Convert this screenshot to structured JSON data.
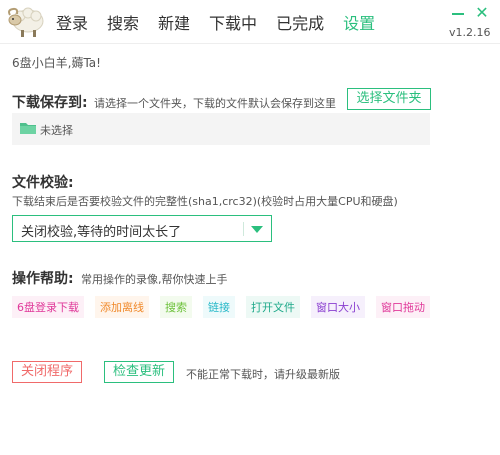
{
  "nav": {
    "items": [
      "登录",
      "搜索",
      "新建",
      "下载中",
      "已完成",
      "设置"
    ],
    "active": 5
  },
  "version": "v1.2.16",
  "greeting": "6盘小白羊,薅Ta!",
  "download": {
    "title": "下载保存到:",
    "desc": "请选择一个文件夹，下载的文件默认会保存到这里",
    "choose_button": "选择文件夹",
    "current_path": "未选择"
  },
  "verify": {
    "title": "文件校验:",
    "desc": "下载结束后是否要校验文件的完整性(sha1,crc32)(校验时占用大量CPU和硬盘)",
    "selected": "关闭校验,等待的时间太长了"
  },
  "help": {
    "title": "操作帮助:",
    "desc": "常用操作的录像,帮你快速上手",
    "links": [
      {
        "label": "6盘登录下载",
        "color": "#e0399a",
        "bg": "#fdf0f7"
      },
      {
        "label": "添加离线",
        "color": "#f08a2c",
        "bg": "#fff5ec"
      },
      {
        "label": "搜索",
        "color": "#6cc13a",
        "bg": "#f3fbee"
      },
      {
        "label": "链接",
        "color": "#27b8c8",
        "bg": "#eefafb"
      },
      {
        "label": "打开文件",
        "color": "#1fa98a",
        "bg": "#edf9f5"
      },
      {
        "label": "窗口大小",
        "color": "#8a3fd0",
        "bg": "#f6f0fc"
      },
      {
        "label": "窗口拖动",
        "color": "#e0399a",
        "bg": "#fdf0f7"
      }
    ]
  },
  "footer": {
    "close_button": "关闭程序",
    "update_button": "检查更新",
    "note": "不能正常下载时，请升级最新版"
  },
  "colors": {
    "accent": "#2bbf7e",
    "danger": "#f06a6a"
  },
  "icons": [
    "sheep-logo-icon",
    "minimize-icon",
    "close-icon",
    "folder-icon",
    "dropdown-arrow-icon"
  ]
}
